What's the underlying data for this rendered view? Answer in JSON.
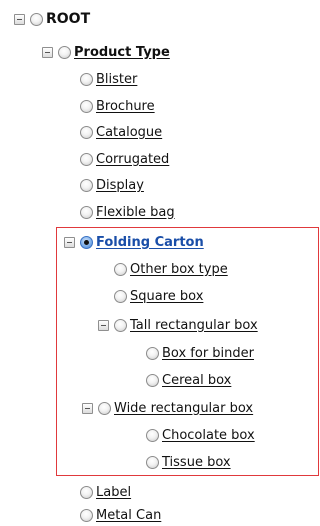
{
  "tree": {
    "root": {
      "label": "ROOT",
      "expanded": true
    },
    "product_type": {
      "label": "Product Type",
      "expanded": true,
      "children": [
        {
          "label": "Blister"
        },
        {
          "label": "Brochure"
        },
        {
          "label": "Catalogue"
        },
        {
          "label": "Corrugated"
        },
        {
          "label": "Display"
        },
        {
          "label": "Flexible bag"
        }
      ],
      "folding_carton": {
        "label": "Folding Carton",
        "selected": true,
        "expanded": true,
        "other_box_type": {
          "label": "Other box type"
        },
        "square_box": {
          "label": "Square box"
        },
        "tall_rectangular_box": {
          "label": "Tall rectangular box",
          "expanded": true,
          "children": [
            {
              "label": "Box for binder"
            },
            {
              "label": "Cereal box"
            }
          ]
        },
        "wide_rectangular_box": {
          "label": "Wide rectangular box",
          "expanded": true,
          "children": [
            {
              "label": "Chocolate box"
            },
            {
              "label": "Tissue box"
            }
          ]
        }
      },
      "after": [
        {
          "label": "Label"
        },
        {
          "label": "Metal Can"
        }
      ]
    }
  },
  "colors": {
    "highlight_border": "#e0393c",
    "selected_radio": "#3d79cf",
    "text": "#111111"
  }
}
